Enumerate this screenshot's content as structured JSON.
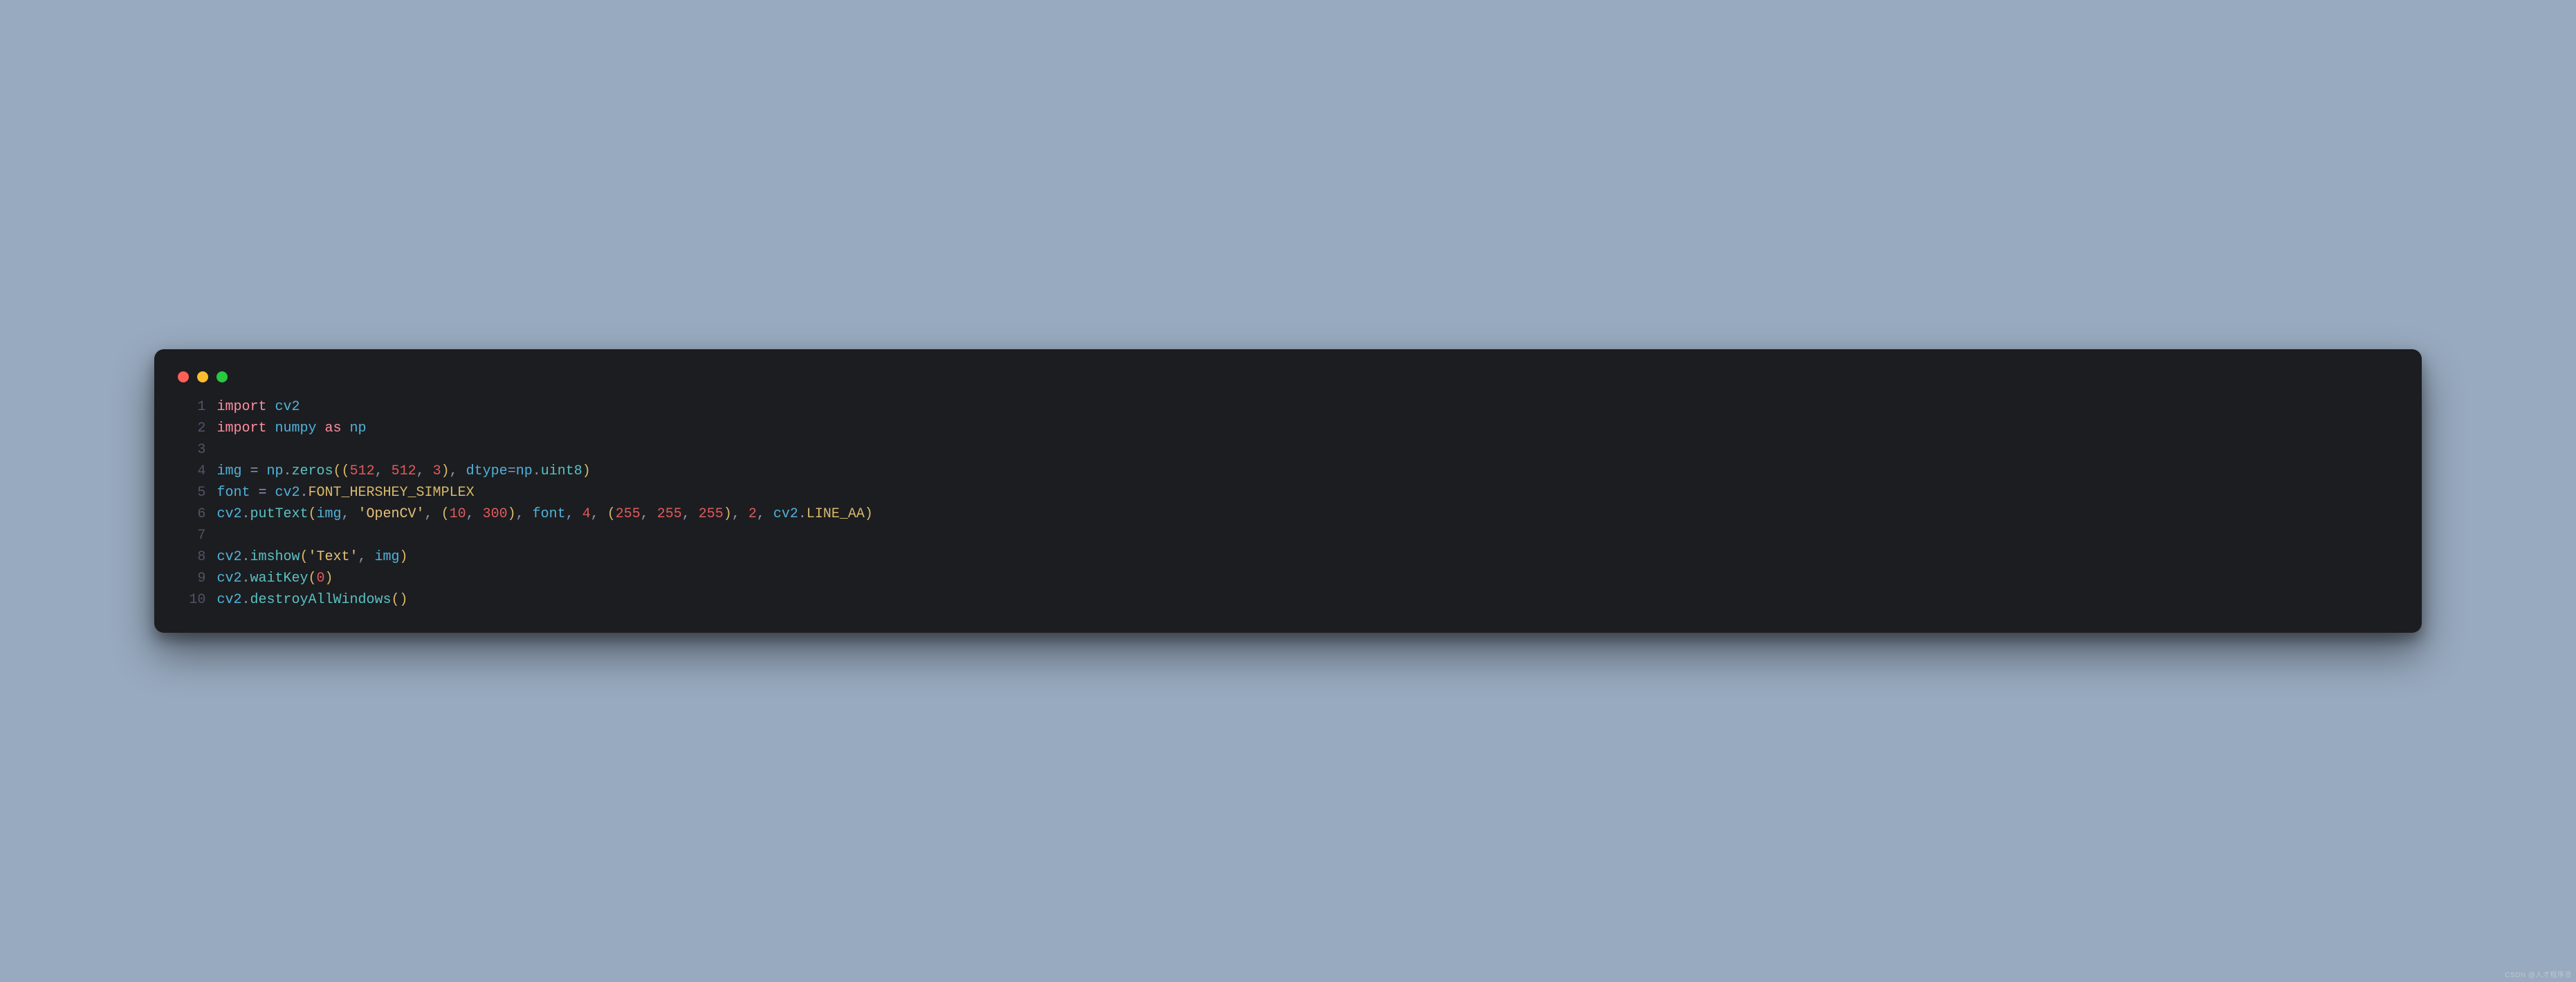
{
  "watermark": "CSDN @人才程序员",
  "window": {
    "traffic_lights": [
      "red",
      "yellow",
      "green"
    ]
  },
  "code": {
    "lines": [
      {
        "n": "1",
        "tokens": [
          {
            "t": "import",
            "c": "c-keyword"
          },
          {
            "t": " ",
            "c": "c-default"
          },
          {
            "t": "cv2",
            "c": "c-module"
          }
        ]
      },
      {
        "n": "2",
        "tokens": [
          {
            "t": "import",
            "c": "c-keyword"
          },
          {
            "t": " ",
            "c": "c-default"
          },
          {
            "t": "numpy",
            "c": "c-module"
          },
          {
            "t": " ",
            "c": "c-default"
          },
          {
            "t": "as",
            "c": "c-keyword"
          },
          {
            "t": " ",
            "c": "c-default"
          },
          {
            "t": "np",
            "c": "c-module"
          }
        ]
      },
      {
        "n": "3",
        "tokens": [
          {
            "t": "",
            "c": "c-default"
          }
        ]
      },
      {
        "n": "4",
        "tokens": [
          {
            "t": "img",
            "c": "c-module"
          },
          {
            "t": " ",
            "c": "c-default"
          },
          {
            "t": "=",
            "c": "c-op"
          },
          {
            "t": " ",
            "c": "c-default"
          },
          {
            "t": "np",
            "c": "c-module"
          },
          {
            "t": ".",
            "c": "c-op"
          },
          {
            "t": "zeros",
            "c": "c-func"
          },
          {
            "t": "((",
            "c": "c-paren"
          },
          {
            "t": "512",
            "c": "c-number"
          },
          {
            "t": ", ",
            "c": "c-op"
          },
          {
            "t": "512",
            "c": "c-number"
          },
          {
            "t": ", ",
            "c": "c-op"
          },
          {
            "t": "3",
            "c": "c-number"
          },
          {
            "t": ")",
            "c": "c-paren"
          },
          {
            "t": ", ",
            "c": "c-op"
          },
          {
            "t": "dtype",
            "c": "c-module"
          },
          {
            "t": "=",
            "c": "c-op"
          },
          {
            "t": "np",
            "c": "c-module"
          },
          {
            "t": ".",
            "c": "c-op"
          },
          {
            "t": "uint8",
            "c": "c-func"
          },
          {
            "t": ")",
            "c": "c-paren"
          }
        ]
      },
      {
        "n": "5",
        "tokens": [
          {
            "t": "font",
            "c": "c-module"
          },
          {
            "t": " ",
            "c": "c-default"
          },
          {
            "t": "=",
            "c": "c-op"
          },
          {
            "t": " ",
            "c": "c-default"
          },
          {
            "t": "cv2",
            "c": "c-module"
          },
          {
            "t": ".",
            "c": "c-op"
          },
          {
            "t": "FONT_HERSHEY_SIMPLEX",
            "c": "c-const"
          }
        ]
      },
      {
        "n": "6",
        "tokens": [
          {
            "t": "cv2",
            "c": "c-module"
          },
          {
            "t": ".",
            "c": "c-op"
          },
          {
            "t": "putText",
            "c": "c-func"
          },
          {
            "t": "(",
            "c": "c-paren"
          },
          {
            "t": "img",
            "c": "c-module"
          },
          {
            "t": ", ",
            "c": "c-op"
          },
          {
            "t": "'OpenCV'",
            "c": "c-string"
          },
          {
            "t": ", ",
            "c": "c-op"
          },
          {
            "t": "(",
            "c": "c-paren"
          },
          {
            "t": "10",
            "c": "c-number"
          },
          {
            "t": ", ",
            "c": "c-op"
          },
          {
            "t": "300",
            "c": "c-number"
          },
          {
            "t": ")",
            "c": "c-paren"
          },
          {
            "t": ", ",
            "c": "c-op"
          },
          {
            "t": "font",
            "c": "c-module"
          },
          {
            "t": ", ",
            "c": "c-op"
          },
          {
            "t": "4",
            "c": "c-number"
          },
          {
            "t": ", ",
            "c": "c-op"
          },
          {
            "t": "(",
            "c": "c-paren"
          },
          {
            "t": "255",
            "c": "c-number"
          },
          {
            "t": ", ",
            "c": "c-op"
          },
          {
            "t": "255",
            "c": "c-number"
          },
          {
            "t": ", ",
            "c": "c-op"
          },
          {
            "t": "255",
            "c": "c-number"
          },
          {
            "t": ")",
            "c": "c-paren"
          },
          {
            "t": ", ",
            "c": "c-op"
          },
          {
            "t": "2",
            "c": "c-number"
          },
          {
            "t": ", ",
            "c": "c-op"
          },
          {
            "t": "cv2",
            "c": "c-module"
          },
          {
            "t": ".",
            "c": "c-op"
          },
          {
            "t": "LINE_AA",
            "c": "c-const"
          },
          {
            "t": ")",
            "c": "c-paren"
          }
        ]
      },
      {
        "n": "7",
        "tokens": [
          {
            "t": "",
            "c": "c-default"
          }
        ]
      },
      {
        "n": "8",
        "tokens": [
          {
            "t": "cv2",
            "c": "c-module"
          },
          {
            "t": ".",
            "c": "c-op"
          },
          {
            "t": "imshow",
            "c": "c-func"
          },
          {
            "t": "(",
            "c": "c-paren"
          },
          {
            "t": "'Text'",
            "c": "c-string"
          },
          {
            "t": ", ",
            "c": "c-op"
          },
          {
            "t": "img",
            "c": "c-module"
          },
          {
            "t": ")",
            "c": "c-paren"
          }
        ]
      },
      {
        "n": "9",
        "tokens": [
          {
            "t": "cv2",
            "c": "c-module"
          },
          {
            "t": ".",
            "c": "c-op"
          },
          {
            "t": "waitKey",
            "c": "c-func"
          },
          {
            "t": "(",
            "c": "c-paren"
          },
          {
            "t": "0",
            "c": "c-number"
          },
          {
            "t": ")",
            "c": "c-paren"
          }
        ]
      },
      {
        "n": "10",
        "tokens": [
          {
            "t": "cv2",
            "c": "c-module"
          },
          {
            "t": ".",
            "c": "c-op"
          },
          {
            "t": "destroyAllWindows",
            "c": "c-func"
          },
          {
            "t": "()",
            "c": "c-paren"
          }
        ]
      }
    ]
  }
}
